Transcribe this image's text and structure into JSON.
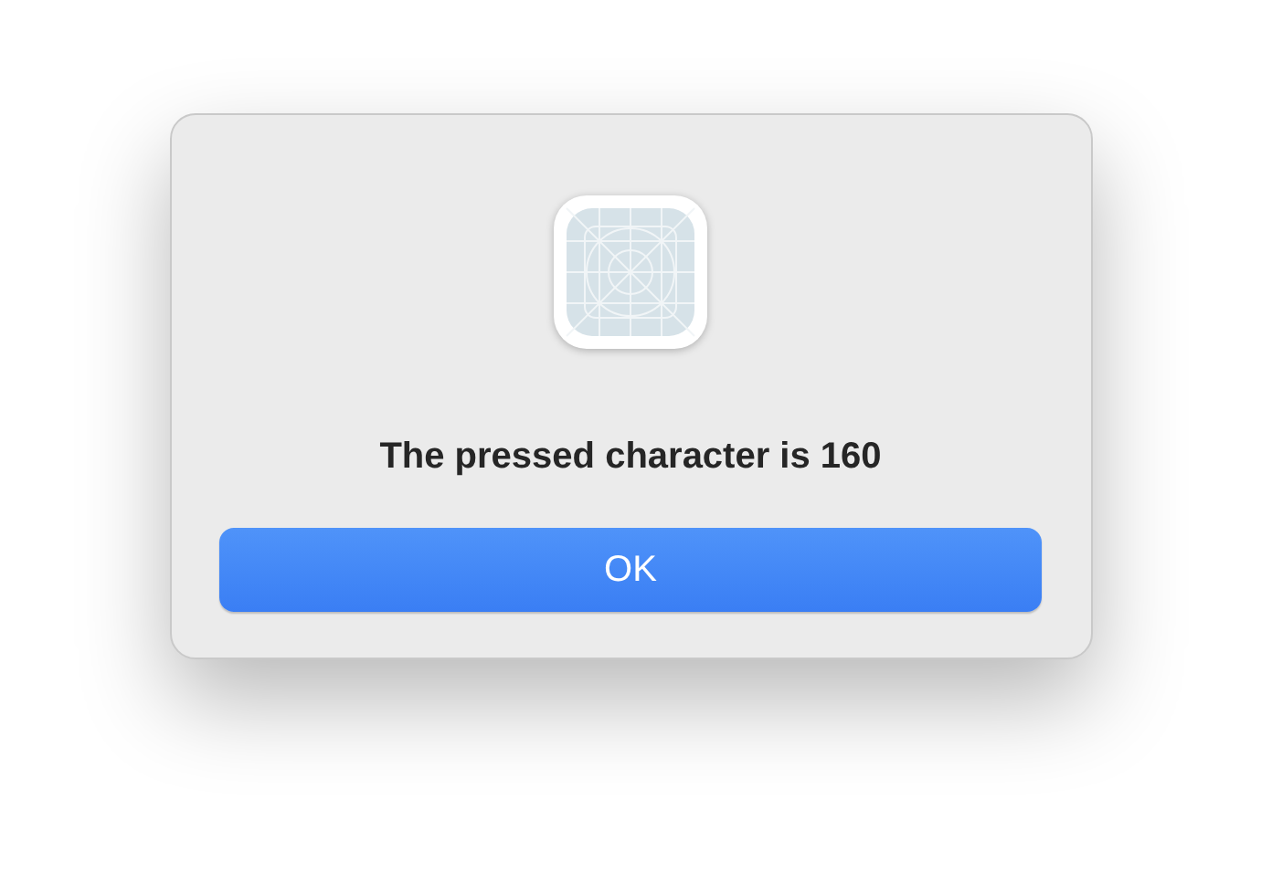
{
  "alert": {
    "message": "The pressed character is 160",
    "button": "OK"
  }
}
